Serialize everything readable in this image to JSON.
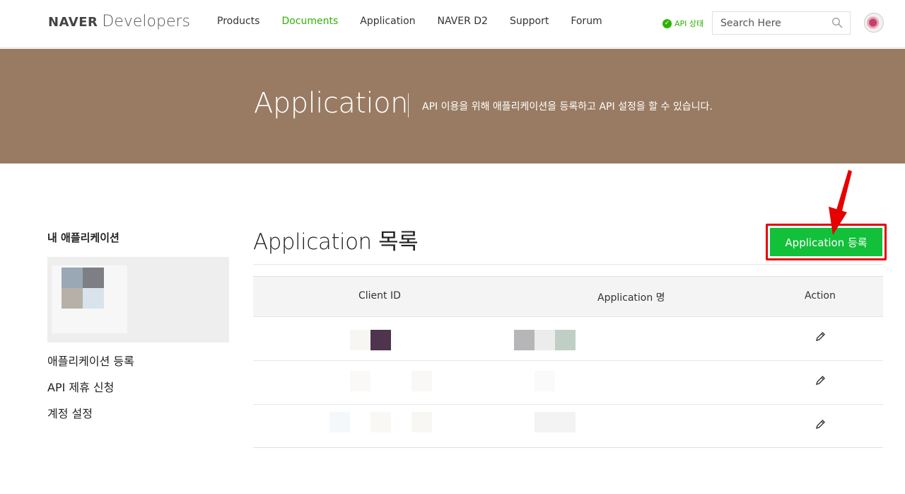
{
  "brand": {
    "naver": "NAVER",
    "developers": "Developers"
  },
  "nav": {
    "items": [
      {
        "label": "Products"
      },
      {
        "label": "Documents"
      },
      {
        "label": "Application"
      },
      {
        "label": "NAVER D2"
      },
      {
        "label": "Support"
      },
      {
        "label": "Forum"
      }
    ],
    "active": "Documents"
  },
  "api_status": {
    "label": "API 상태",
    "icon": "check-circle-icon"
  },
  "search": {
    "placeholder": "Search Here",
    "icon": "search-icon"
  },
  "banner": {
    "title": "Application",
    "description": "API 이용을 위해 애플리케이션을 등록하고 API 설정을 할 수 있습니다."
  },
  "sidebar": {
    "title": "내 애플리케이션",
    "links": [
      {
        "label": "애플리케이션 등록"
      },
      {
        "label": "API 제휴 신청"
      },
      {
        "label": "계정 설정"
      }
    ]
  },
  "main": {
    "title": "Application 목록",
    "register_button": "Application 등록",
    "table": {
      "headers": {
        "client_id": "Client ID",
        "app_name": "Application 명",
        "action": "Action"
      },
      "row_count": 3,
      "action_icon": "pencil-icon"
    }
  },
  "colors": {
    "accent": "#2db400",
    "banner": "#987b62",
    "button": "#12c03a",
    "highlight": "#e60000"
  }
}
